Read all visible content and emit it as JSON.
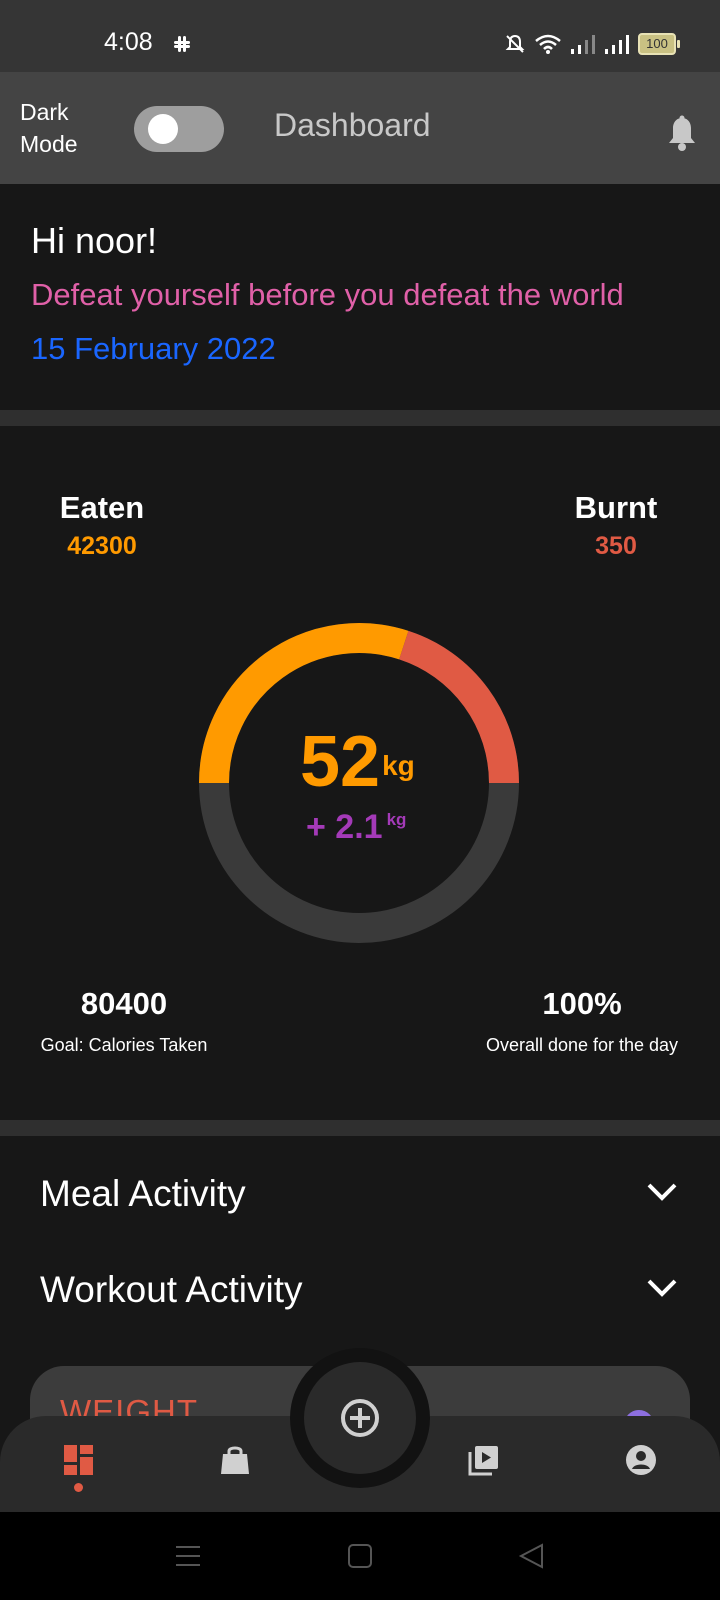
{
  "status_bar": {
    "time": "4:08",
    "battery": "100",
    "icons": [
      "slack-icon",
      "bell-off-icon",
      "wifi-icon",
      "signal-icon",
      "signal-icon",
      "battery-icon"
    ]
  },
  "app_bar": {
    "dark_mode_label": "Dark Mode",
    "dark_mode_on": false,
    "title": "Dashboard",
    "notification_icon": "bell-icon"
  },
  "greeting": {
    "hi": "Hi noor!",
    "quote": "Defeat yourself before you defeat the world",
    "date": "15 February 2022"
  },
  "summary": {
    "eaten_label": "Eaten",
    "eaten_value": "42300",
    "burnt_label": "Burnt",
    "burnt_value": "350",
    "weight": "52",
    "weight_unit": "kg",
    "weight_change": "+ 2.1",
    "weight_change_unit": "kg",
    "ring": {
      "eaten_fraction": 0.3,
      "burnt_fraction": 0.2,
      "eaten_color": "#ff9a00",
      "burnt_color": "#e05a44",
      "track_color": "#3a3a3a"
    },
    "goal_value": "80400",
    "goal_label": "Goal: Calories Taken",
    "overall_value": "100%",
    "overall_label": "Overall done for the day"
  },
  "accordions": [
    {
      "label": "Meal Activity",
      "icon": "chevron-down-icon"
    },
    {
      "label": "Workout Activity",
      "icon": "chevron-down-icon"
    }
  ],
  "weight_card": {
    "title": "WEIGHT"
  },
  "bottom_nav": {
    "items": [
      "dashboard-icon",
      "shopping-bag-icon",
      "add-circle-icon",
      "video-library-icon",
      "account-icon"
    ],
    "active": "dashboard-icon"
  },
  "system_nav": [
    "menu-icon",
    "home-square-icon",
    "back-icon"
  ],
  "colors": {
    "accent_orange": "#ff9a00",
    "accent_red": "#e05a44",
    "accent_purple": "#a43ab8",
    "quote_pink": "#e060a8",
    "date_blue": "#1a66ff"
  }
}
